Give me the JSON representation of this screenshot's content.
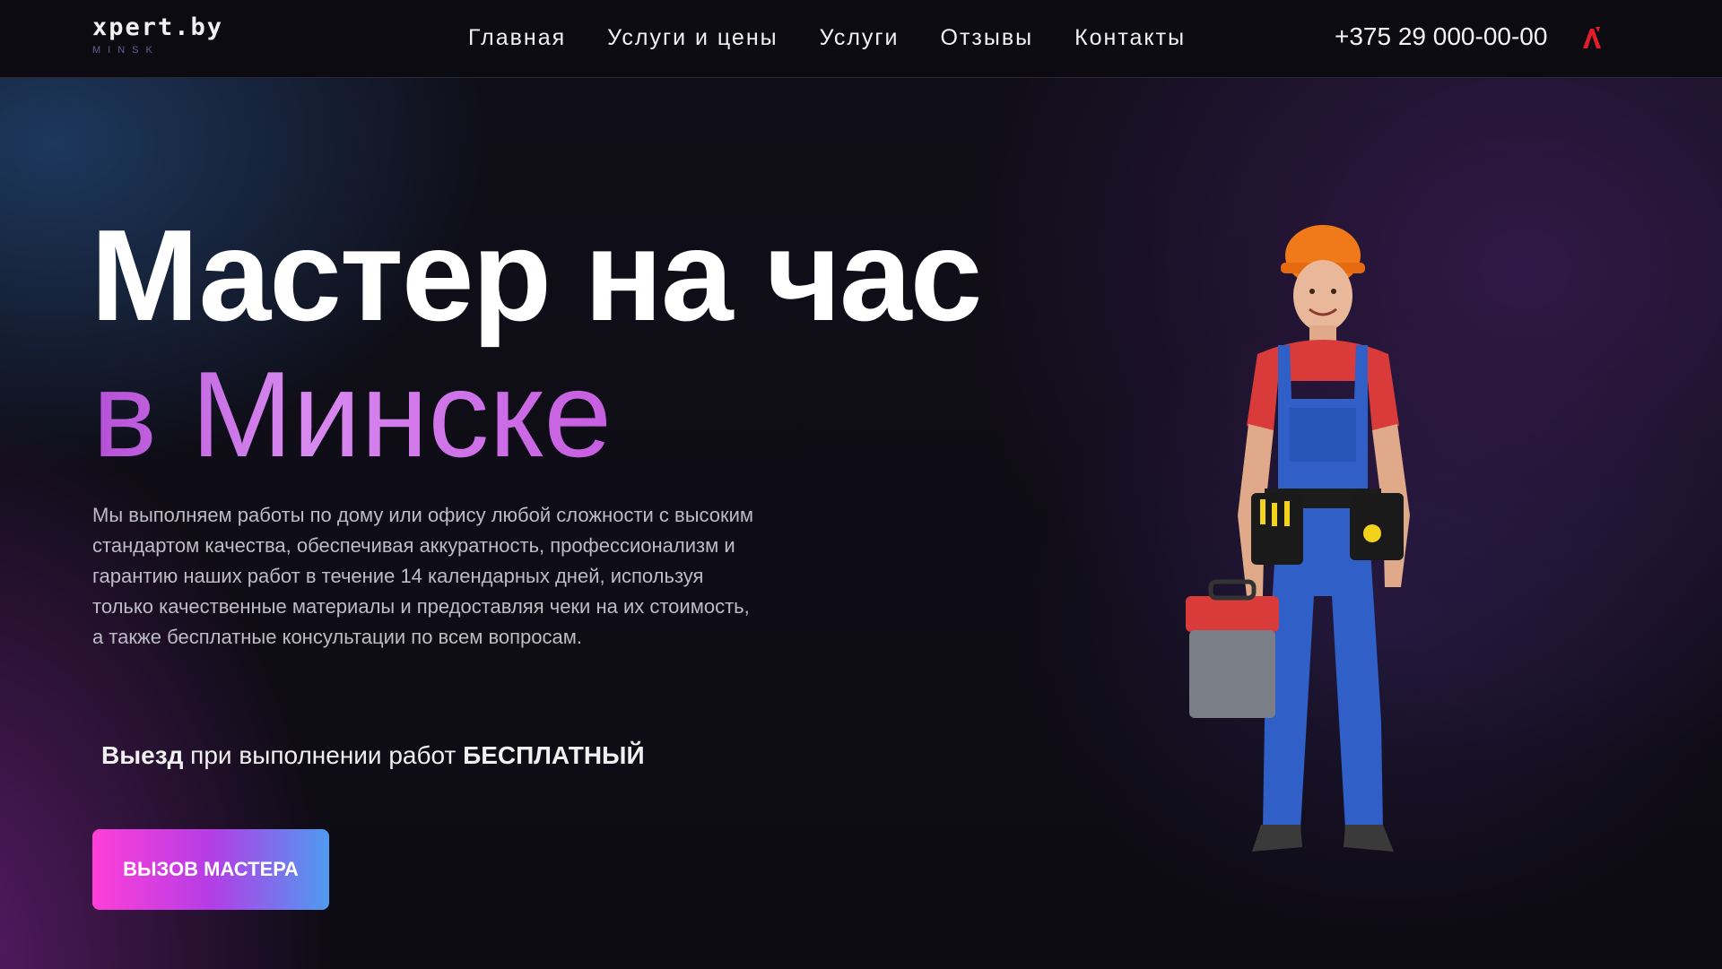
{
  "header": {
    "logo_main": "xpert.by",
    "logo_sub": "MINSK",
    "nav": [
      "Главная",
      "Услуги и цены",
      "Услуги",
      "Отзывы",
      "Контакты"
    ],
    "phone": "+375 29 000-00-00",
    "phone_icon": "operator-logo-icon"
  },
  "hero": {
    "title_line1": "Мастер на час",
    "title_line2": "в Минске",
    "description": "Мы выполняем работы по дому или офису любой сложности с высоким стандартом качества, обеспечивая аккуратность, профессионализм и гарантию наших работ в течение 14 календарных дней, используя только качественные материалы и предоставляя чеки на их стоимость, а также бесплатные консультации по всем вопросам.",
    "note_bold_1": "Выезд",
    "note_text": " при выполнении работ ",
    "note_bold_2": "БЕСПЛАТНЫЙ",
    "cta_label": "ВЫЗОВ МАСТЕРА",
    "image": "handyman-worker-illustration"
  },
  "colors": {
    "background": "#0e0c16",
    "header": "#0c0b11",
    "accent_pink": "#ff3fd8",
    "accent_purple": "#b43de6",
    "accent_blue": "#4e9bf0",
    "title_gradient": "#c65de0"
  }
}
